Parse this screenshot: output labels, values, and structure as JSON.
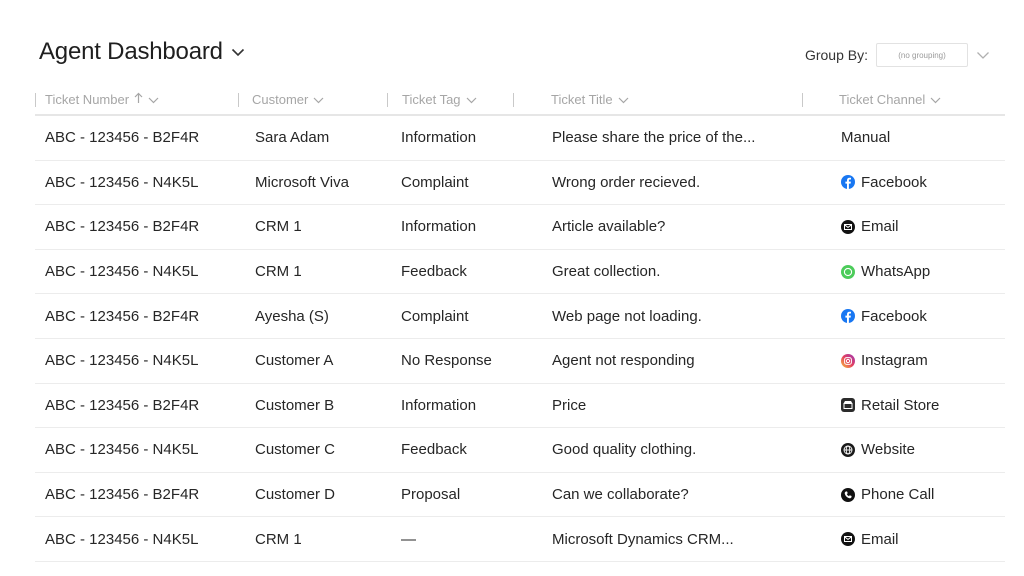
{
  "header": {
    "title": "Agent Dashboard",
    "group_by_label": "Group By:",
    "group_by_value": "(no grouping)"
  },
  "columns": [
    {
      "label": "Ticket Number",
      "sorted": "ascending"
    },
    {
      "label": "Customer"
    },
    {
      "label": "Ticket Tag"
    },
    {
      "label": "Ticket Title"
    },
    {
      "label": "Ticket Channel"
    }
  ],
  "rows": [
    {
      "ticket": "ABC - 123456 - B2F4R",
      "customer": "Sara Adam",
      "tag": "Information",
      "title": "Please share the price of the...",
      "channel": "Manual",
      "channel_icon": "none"
    },
    {
      "ticket": "ABC - 123456 - N4K5L",
      "customer": "Microsoft Viva",
      "tag": "Complaint",
      "title": "Wrong order recieved.",
      "channel": "Facebook",
      "channel_icon": "facebook-icon"
    },
    {
      "ticket": "ABC - 123456 - B2F4R",
      "customer": "CRM 1",
      "tag": "Information",
      "title": "Article available?",
      "channel": "Email",
      "channel_icon": "email-icon"
    },
    {
      "ticket": "ABC - 123456 - N4K5L",
      "customer": "CRM 1",
      "tag": "Feedback",
      "title": "Great collection.",
      "channel": "WhatsApp",
      "channel_icon": "whatsapp-icon"
    },
    {
      "ticket": "ABC - 123456 - B2F4R",
      "customer": "Ayesha (S)",
      "tag": "Complaint",
      "title": "Web page not loading.",
      "channel": "Facebook",
      "channel_icon": "facebook-icon"
    },
    {
      "ticket": "ABC - 123456 - N4K5L",
      "customer": "Customer A",
      "tag": "No Response",
      "title": "Agent not responding",
      "channel": "Instagram",
      "channel_icon": "instagram-icon"
    },
    {
      "ticket": "ABC - 123456 - B2F4R",
      "customer": "Customer B",
      "tag": "Information",
      "title": "Price",
      "channel": "Retail Store",
      "channel_icon": "retail-store-icon"
    },
    {
      "ticket": "ABC - 123456 - N4K5L",
      "customer": "Customer C",
      "tag": "Feedback",
      "title": "Good quality clothing.",
      "channel": "Website",
      "channel_icon": "website-icon"
    },
    {
      "ticket": "ABC - 123456 - B2F4R",
      "customer": "Customer D",
      "tag": "Proposal",
      "title": "Can we collaborate?",
      "channel": "Phone Call",
      "channel_icon": "phone-icon"
    },
    {
      "ticket": "ABC - 123456 - N4K5L",
      "customer": "CRM 1",
      "tag": "—",
      "title": "Microsoft Dynamics CRM...",
      "channel": "Email",
      "channel_icon": "email-icon"
    }
  ],
  "colors": {
    "facebook": "#1877f2",
    "whatsapp": "#4ccc5a",
    "header_text": "#a6a6a6",
    "row_divider": "#ececec"
  }
}
